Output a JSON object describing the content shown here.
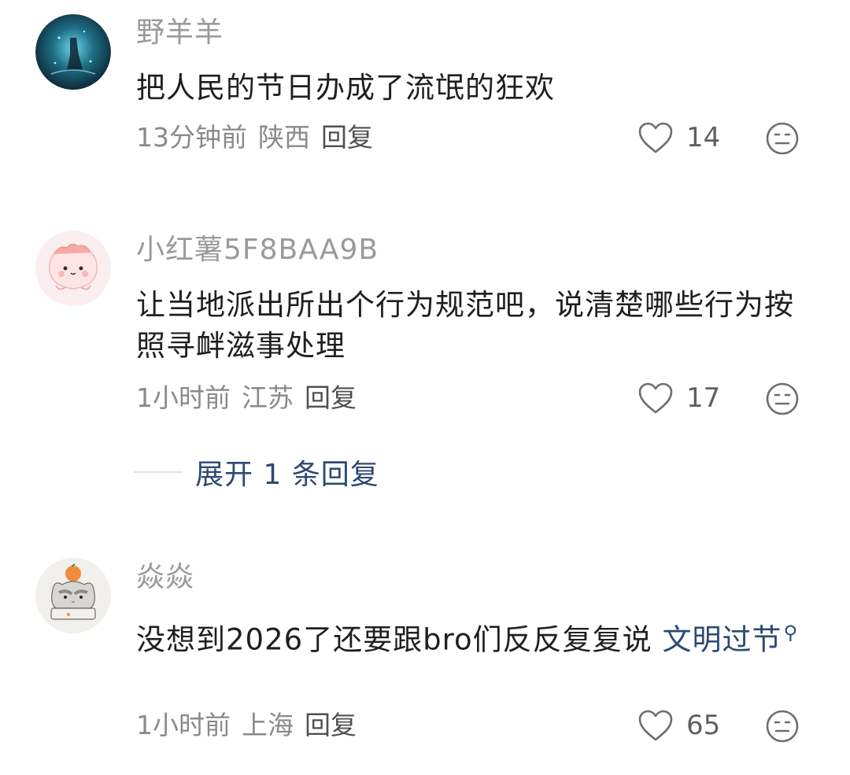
{
  "comments": [
    {
      "username": "野羊羊",
      "content": "把人民的节日办成了流氓的狂欢",
      "time": "13分钟前",
      "location": "陕西",
      "reply_label": "回复",
      "likes": "14",
      "avatar_icon": "dark-blue-night-avatar",
      "like_icon": "heart-outline-icon",
      "dislike_icon": "neutral-face-icon"
    },
    {
      "username": "小红薯5F8BAA9B",
      "content": "让当地派出所出个行为规范吧，说清楚哪些行为按照寻衅滋事处理",
      "time": "1小时前",
      "location": "江苏",
      "reply_label": "回复",
      "likes": "17",
      "avatar_icon": "pink-blob-avatar",
      "like_icon": "heart-outline-icon",
      "dislike_icon": "neutral-face-icon",
      "expand_replies_label": "展开 1 条回复"
    },
    {
      "username": "焱焱",
      "content_text": "没想到2026了还要跟bro们反反复复说 ",
      "topic_link": "文明过节",
      "topic_icon": "search-icon",
      "time": "1小时前",
      "location": "上海",
      "reply_label": "回复",
      "likes": "65",
      "avatar_icon": "cat-with-orange-avatar",
      "like_icon": "heart-outline-icon",
      "dislike_icon": "neutral-face-icon"
    }
  ],
  "colors": {
    "link": "#2c4a72",
    "meta": "#8a8a8a",
    "username": "#9a9a9a"
  }
}
